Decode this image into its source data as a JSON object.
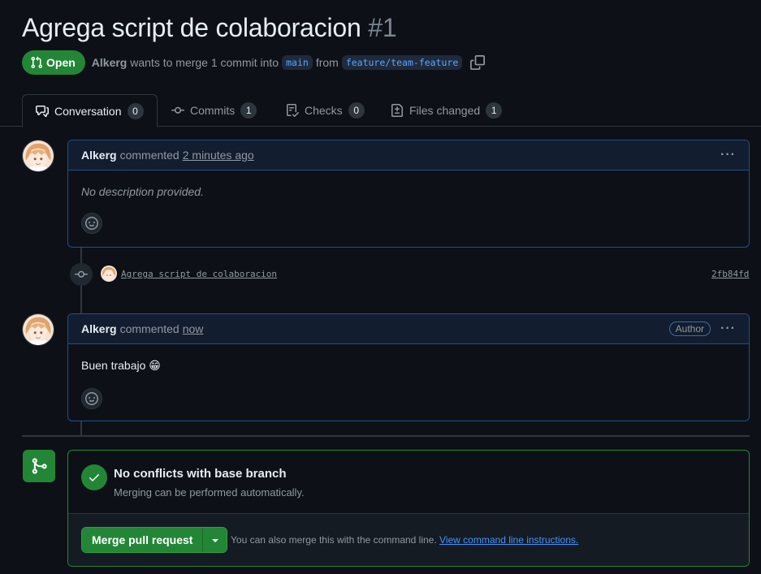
{
  "pr": {
    "title": "Agrega script de colaboracion",
    "number": "#1",
    "state": "Open",
    "author": "Alkerg",
    "merge_text": "wants to merge 1 commit into",
    "base_branch": "main",
    "from_text": "from",
    "head_branch": "feature/team-feature"
  },
  "tabs": [
    {
      "label": "Conversation",
      "count": "0",
      "icon": "comment-discussion-icon"
    },
    {
      "label": "Commits",
      "count": "1",
      "icon": "git-commit-icon"
    },
    {
      "label": "Checks",
      "count": "0",
      "icon": "checklist-icon"
    },
    {
      "label": "Files changed",
      "count": "1",
      "icon": "file-diff-icon"
    }
  ],
  "comments": [
    {
      "author": "Alkerg",
      "action": "commented",
      "time": "2 minutes ago",
      "body": "No description provided.",
      "badge": ""
    },
    {
      "author": "Alkerg",
      "action": "commented",
      "time": "now",
      "body": "Buen trabajo",
      "emoji": "😁",
      "badge": "Author"
    }
  ],
  "commit": {
    "message": "Agrega script de colaboracion",
    "sha": "2fb84fd"
  },
  "merge": {
    "title": "No conflicts with base branch",
    "subtitle": "Merging can be performed automatically.",
    "button": "Merge pull request",
    "hint": "You can also merge this with the command line.",
    "hint_link": "View command line instructions."
  },
  "colors": {
    "background": "#0d1117",
    "accent_green": "#238636",
    "link_blue": "#4493f8",
    "comment_border": "#1f4f8a"
  }
}
